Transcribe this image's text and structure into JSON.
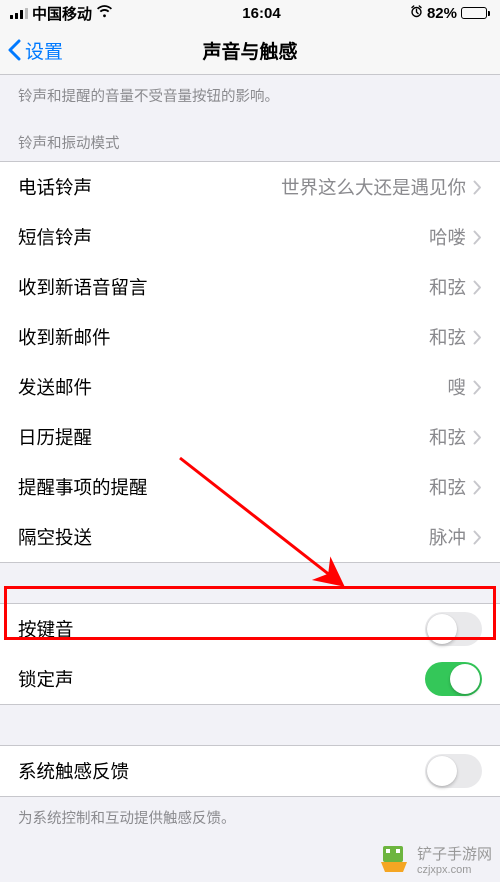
{
  "status": {
    "carrier": "中国移动",
    "time": "16:04",
    "battery_pct": "82%"
  },
  "nav": {
    "back_label": "设置",
    "title": "声音与触感"
  },
  "descriptions": {
    "top": "铃声和提醒的音量不受音量按钮的影响。",
    "section_header": "铃声和振动模式",
    "footer": "为系统控制和互动提供触感反馈。"
  },
  "ringtone_items": [
    {
      "label": "电话铃声",
      "value": "世界这么大还是遇见你"
    },
    {
      "label": "短信铃声",
      "value": "哈喽"
    },
    {
      "label": "收到新语音留言",
      "value": "和弦"
    },
    {
      "label": "收到新邮件",
      "value": "和弦"
    },
    {
      "label": "发送邮件",
      "value": "嗖"
    },
    {
      "label": "日历提醒",
      "value": "和弦"
    },
    {
      "label": "提醒事项的提醒",
      "value": "和弦"
    },
    {
      "label": "隔空投送",
      "value": "脉冲"
    }
  ],
  "toggle_items_1": [
    {
      "label": "按键音",
      "on": false
    },
    {
      "label": "锁定声",
      "on": true
    }
  ],
  "toggle_items_2": [
    {
      "label": "系统触感反馈",
      "on": false
    }
  ],
  "watermark": {
    "text": "铲子手游网",
    "url": "czjxpx.com"
  }
}
